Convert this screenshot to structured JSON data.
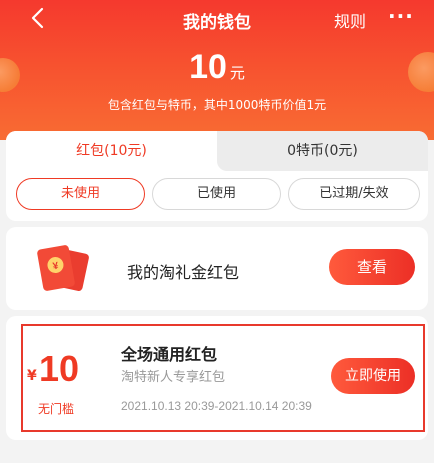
{
  "header": {
    "title": "我的钱包",
    "rules_label": "规则",
    "more_label": "···",
    "amount_value": "10",
    "amount_unit": "元",
    "subtitle": "包含红包与特币，其中1000特币价值1元"
  },
  "tabs": [
    {
      "label": "红包(10元)",
      "active": true
    },
    {
      "label": "0特币(0元)",
      "active": false
    }
  ],
  "filters": [
    {
      "label": "未使用",
      "selected": true
    },
    {
      "label": "已使用",
      "selected": false
    },
    {
      "label": "已过期/失效",
      "selected": false
    }
  ],
  "gift_packet": {
    "label": "我的淘礼金红包",
    "button_label": "查看",
    "icon": "red-envelope-icon"
  },
  "coupon": {
    "currency": "¥",
    "value": "10",
    "threshold_label": "无门槛",
    "title": "全场通用红包",
    "subtitle": "淘特新人专享红包",
    "validity": "2021.10.13 20:39-2021.10.14 20:39",
    "button_label": "立即使用"
  },
  "colors": {
    "accent": "#ef3a24",
    "header_top": "#f5392e",
    "header_bottom": "#f86c33",
    "page_bg": "#f3f3f3"
  }
}
